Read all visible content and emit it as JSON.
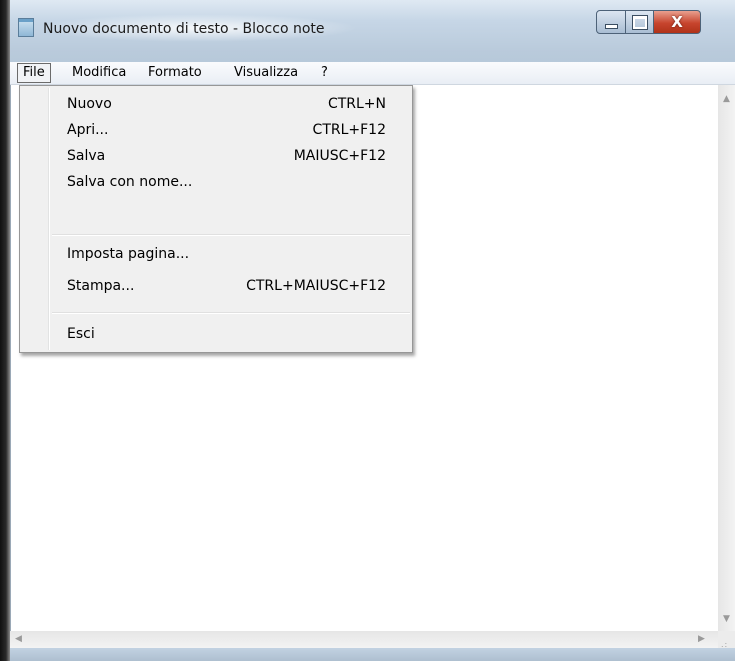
{
  "window": {
    "title": "Nuovo documento di testo - Blocco note",
    "close_label": "X"
  },
  "menubar": {
    "items": [
      "File",
      "Modifica",
      "Formato",
      "Visualizza",
      "?"
    ],
    "open_index": 0
  },
  "file_menu": {
    "items": [
      {
        "label": "Nuovo",
        "shortcut": "CTRL+N"
      },
      {
        "label": "Apri...",
        "shortcut": "CTRL+F12"
      },
      {
        "label": "Salva",
        "shortcut": "MAIUSC+F12"
      },
      {
        "label": "Salva con nome...",
        "shortcut": ""
      },
      {
        "label": "Imposta pagina...",
        "shortcut": ""
      },
      {
        "label": "Stampa...",
        "shortcut": "CTRL+MAIUSC+F12"
      },
      {
        "label": "Esci",
        "shortcut": ""
      }
    ]
  },
  "editor": {
    "content": ""
  }
}
